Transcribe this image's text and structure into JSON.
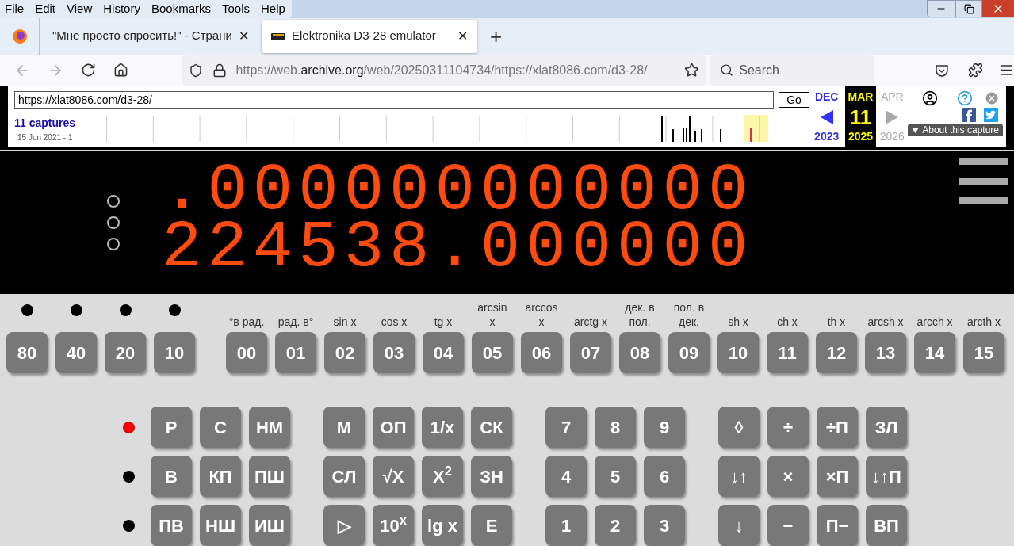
{
  "menu_bar": [
    "File",
    "Edit",
    "View",
    "History",
    "Bookmarks",
    "Tools",
    "Help"
  ],
  "tabs": [
    {
      "title": "\"Мне просто спросить!\" - Страни",
      "close": "✕",
      "selected": false
    },
    {
      "title": "Elektronika D3-28 emulator",
      "close": "✕",
      "selected": true
    }
  ],
  "new_tab": "+",
  "address_bar": {
    "url_start": "https://web.",
    "url_domain": "archive.org",
    "url_end": "/web/20250311104734/https://xlat8086.com/d3-28/"
  },
  "search": {
    "placeholder": "Search"
  },
  "wayback": {
    "url": "https://xlat8086.com/d3-28/",
    "go": "Go",
    "captures": "11 captures",
    "date_range": "15 Jun 2021 - 1",
    "prev": {
      "month": "DEC",
      "year": "2023"
    },
    "current": {
      "month": "MAR",
      "day": "11",
      "year": "2025"
    },
    "next": {
      "month": "APR",
      "year": "2026"
    },
    "about": "About this capture"
  },
  "display": {
    "indicators": [
      {
        "on": false
      },
      {
        "on": false
      },
      {
        "on": false
      }
    ],
    "rows": [
      ".000000000000",
      "224538.000000"
    ]
  },
  "register_keys": [
    {
      "label": "80",
      "led_on": false
    },
    {
      "label": "40",
      "led_on": false
    },
    {
      "label": "20",
      "led_on": false
    },
    {
      "label": "10",
      "led_on": false
    }
  ],
  "function_keys": [
    {
      "caption": "°в рад.",
      "label": "00"
    },
    {
      "caption": "рад. в°",
      "label": "01"
    },
    {
      "caption": "sin x",
      "label": "02"
    },
    {
      "caption": "cos x",
      "label": "03"
    },
    {
      "caption": "tg x",
      "label": "04"
    },
    {
      "caption": "arcsin x",
      "label": "05"
    },
    {
      "caption": "arccos x",
      "label": "06"
    },
    {
      "caption": "arctg x",
      "label": "07"
    },
    {
      "caption": "дек. в пол.",
      "label": "08"
    },
    {
      "caption": "пол. в дек.",
      "label": "09"
    },
    {
      "caption": "sh x",
      "label": "10"
    },
    {
      "caption": "ch x",
      "label": "11"
    },
    {
      "caption": "th x",
      "label": "12"
    },
    {
      "caption": "arcsh x",
      "label": "13"
    },
    {
      "caption": "arcch x",
      "label": "14"
    },
    {
      "caption": "arcth x",
      "label": "15"
    }
  ],
  "keypad_rows": [
    {
      "led_on": true,
      "groups": [
        [
          "Р",
          "С",
          "НМ"
        ],
        [
          "М",
          "ОП",
          "1/x",
          "СК"
        ],
        [
          "7",
          "8",
          "9"
        ],
        [
          "◊",
          "÷",
          "÷П",
          "ЗЛ"
        ]
      ]
    },
    {
      "led_on": false,
      "groups": [
        [
          "В",
          "КП",
          "ПШ"
        ],
        [
          "СЛ",
          "√X",
          "X$^{2}$",
          "ЗН"
        ],
        [
          "4",
          "5",
          "6"
        ],
        [
          "↓↑",
          "×",
          "×П",
          "↓↑П"
        ]
      ]
    },
    {
      "led_on": false,
      "groups": [
        [
          "ПВ",
          "НШ",
          "ИШ"
        ],
        [
          "▷",
          "10$^{x}$",
          "lg x",
          "E"
        ],
        [
          "1",
          "2",
          "3"
        ],
        [
          "↓",
          "−",
          "П−",
          "ВП"
        ]
      ]
    }
  ]
}
